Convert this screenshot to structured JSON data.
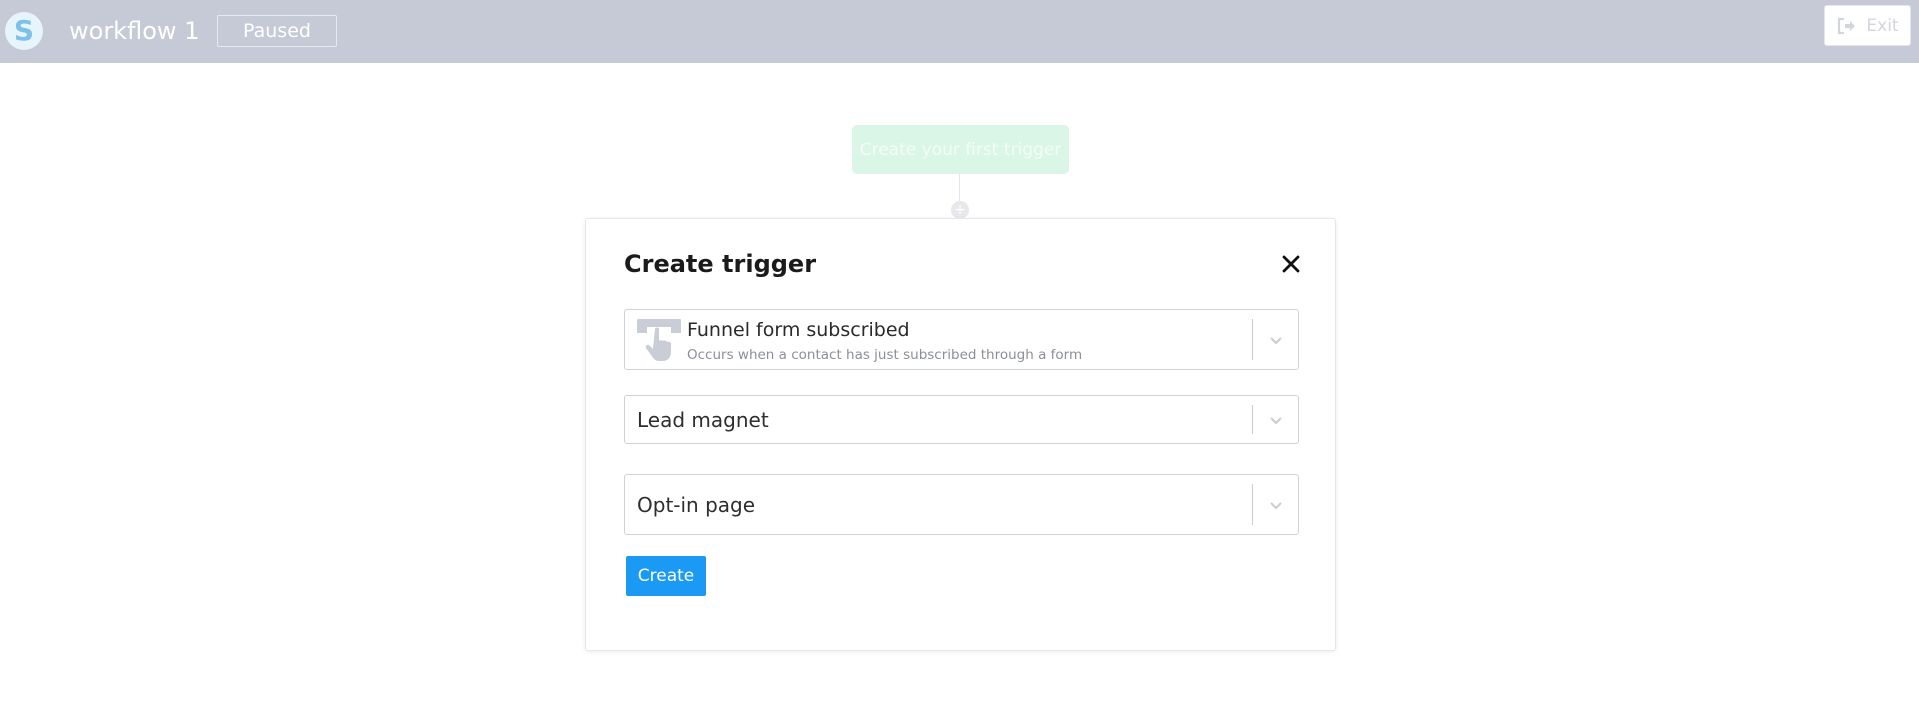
{
  "header": {
    "logo_letter": "S",
    "workflow_title": "workflow 1",
    "status": "Paused",
    "exit_label": "Exit"
  },
  "canvas": {
    "trigger_node_label": "Create your first trigger",
    "add_icon": "plus-icon"
  },
  "modal": {
    "title": "Create trigger",
    "close_icon": "close-icon",
    "event_select": {
      "value": "Funnel form subscribed",
      "description": "Occurs when a contact has just subscribed through a form",
      "icon": "pointer-form-icon"
    },
    "lead_magnet_select": {
      "value": "Lead magnet"
    },
    "optin_select": {
      "value": "Opt-in page"
    },
    "create_label": "Create"
  },
  "colors": {
    "header_bg": "#c5cad6",
    "primary": "#1a9af4",
    "trigger_node_bg": "#d9f6e6"
  }
}
